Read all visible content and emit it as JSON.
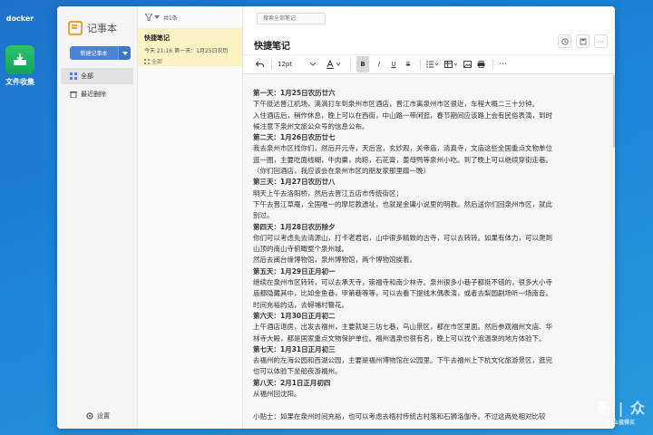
{
  "desktop": {
    "icons": [
      {
        "label": "docker"
      },
      {
        "label": "文件收集"
      }
    ]
  },
  "app": {
    "name": "记事本",
    "new_note_label": "新建记事本",
    "nav": [
      {
        "label": "全部"
      },
      {
        "label": "最近删除"
      }
    ],
    "settings_label": "设置"
  },
  "list": {
    "count_label": "共1条",
    "notes": [
      {
        "title": "快捷笔记",
        "preview": "今天 21:16 第一天：1月25日农历",
        "category": "全部"
      }
    ]
  },
  "editor": {
    "search_placeholder": "搜索全部笔记",
    "title": "快捷笔记",
    "font_size": "12pt",
    "lines": [
      {
        "text": "第一天：1月25日农历廿六",
        "bold": true
      },
      {
        "text": "下午抵达晋江机场，滴滴打车到泉州市区酒店，晋江市离泉州市区很近，车程大概二三十分钟。",
        "bold": false
      },
      {
        "text": "入住酒店后，稍作休息，晚上可以在西街，中山路一带闲逛，春节期间应该路上会有民俗表演，到时",
        "bold": false
      },
      {
        "text": "候注意下泉州文旅公众号的信息公布。",
        "bold": false
      },
      {
        "text": "第二天：1月26日农历廿七",
        "bold": true
      },
      {
        "text": "我去泉州市区找你们，然后开元寺，天后宫，玄妙观，关帝庙，清真寺，文庙这些全国重点文物单位",
        "bold": false
      },
      {
        "text": "逛一圈，主要吃面线糊，牛肉羹，肉粽，石花膏，姜母鸭等泉州小吃。到了晚上可以继续穿街走巷。",
        "bold": false
      },
      {
        "text": "（你们回酒店，我应该会在泉州市区的朋友家那里蹭一晚）",
        "bold": false
      },
      {
        "text": "第三天：1月27日农历廿八",
        "bold": true
      },
      {
        "text": "明天上午去洛阳桥，然后去晋江五店市传统街区；",
        "bold": false
      },
      {
        "text": "下午去晋江草庵，全国唯一的摩尼教遗址，也就是金庸小说里的明教。然后送你们回泉州市区，就此",
        "bold": false
      },
      {
        "text": "别过。",
        "bold": false
      },
      {
        "text": "第四天：1月28日农历除夕",
        "bold": true
      },
      {
        "text": "你们可以考虑先去清源山，打卡老君岩，山中很多精致的古寺，可以去转转。如果有体力，可以爬到",
        "bold": false
      },
      {
        "text": "山顶的南山寺俯瞰整个泉州城。",
        "bold": false
      },
      {
        "text": "然后去闽台缘博物馆，泉州博物馆，两个博物馆挨着。",
        "bold": false
      },
      {
        "text": "第五天：1月29日正月初一",
        "bold": true
      },
      {
        "text": "继续在泉州市区转转，可以去承天寺，崇福寺和南少林寺。泉州很多小巷子都挺不错的，很多大小寺",
        "bold": false
      },
      {
        "text": "庙都隐藏其中，比如金鱼巷，甲第巷等等，可以去看下提线木偶表演，或者去梨园剧场听一场南音。",
        "bold": false
      },
      {
        "text": "时间充裕的话，去蟳埔村簪花。",
        "bold": false
      },
      {
        "text": "第六天：1月30日正月初二",
        "bold": true
      },
      {
        "text": "上午酒店退房，出发去福州，主要就是三坊七巷，乌山景区，都在市区里面。然后参观福州文庙、华",
        "bold": false
      },
      {
        "text": "林寺大殿，都是国家重点文物保护单位。福州温泉也很有名，晚上可以找个泡温泉的地方体验下。",
        "bold": false
      },
      {
        "text": "第七天：1月31日正月初三",
        "bold": true
      },
      {
        "text": "去福州的左海公园和西湖公园，主要是福州博物馆在公园里。下午去福州上下杭文化旅游景区，逛完",
        "bold": false
      },
      {
        "text": "也可以体验下坐船夜游福州。",
        "bold": false
      },
      {
        "text": "第八天：2月1日正月初四",
        "bold": true
      },
      {
        "text": "从福州回沈阳。",
        "bold": false
      },
      {
        "text": "",
        "bold": false
      },
      {
        "text": "小贴士：如果在泉州时间充裕，也可以考虑去梧村传统古村落和石狮洛伽寺。不过这两处相对比较",
        "bold": false
      }
    ]
  },
  "watermark": {
    "main": "新 | 众",
    "sub": "什么值得买"
  },
  "colors": {
    "accent": "#4b83d8",
    "note_highlight": "#fcf3c2",
    "desktop_bg": "#1c86d8"
  }
}
